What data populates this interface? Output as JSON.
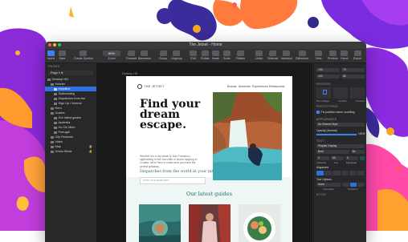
{
  "window": {
    "title": "The Jetset - Home"
  },
  "toolbar": {
    "left_items": [
      "Insert",
      "Data",
      "Create Symbol"
    ],
    "zoom_value": "80%",
    "zoom_label": "Zoom",
    "mid_items": [
      "Forward",
      "Backward",
      "Group",
      "Ungroup",
      "Edit",
      "Rotate",
      "Mask",
      "Scale",
      "Flatten",
      "Union",
      "Subtract",
      "Intersect",
      "Difference"
    ],
    "right_items": [
      "View",
      "Preview",
      "Cloud",
      "Export"
    ]
  },
  "layers_panel": {
    "header": "PAGES",
    "page_selector": "Page 1 ▾",
    "items": [
      {
        "label": "Desktop HD",
        "selected": false
      },
      {
        "label": "Header",
        "selected": false
      },
      {
        "label": "Headline",
        "selected": true
      },
      {
        "label": "Subheading",
        "selected": false
      },
      {
        "label": "Dispatches from the",
        "selected": false
      },
      {
        "label": "Sign Up / Normal",
        "selected": false
      },
      {
        "label": "Hero",
        "selected": false
      },
      {
        "label": "Guides",
        "selected": false
      },
      {
        "label": "Our latest guides",
        "selected": false
      },
      {
        "label": "Australia",
        "selected": false
      },
      {
        "label": "Ho Chi Minh",
        "selected": false
      },
      {
        "label": "Portugal",
        "selected": false
      },
      {
        "label": "City Features",
        "selected": false
      },
      {
        "label": "Video",
        "selected": false
      },
      {
        "label": "Map",
        "selected": false
      },
      {
        "label": "Green Block",
        "selected": false
      }
    ]
  },
  "canvas": {
    "artboard_label": "Desktop HD",
    "brand": "THE JETSET",
    "nav": [
      "Brands",
      "Moments",
      "Experiences",
      "Restaurants"
    ],
    "headline": "Find your dream escape.",
    "paragraph": "Whether it's a city break to San Francisco, sightseeing in the Sea cliffs or island hopping in Croatia, we're here to make sure you have the perfect getaway.",
    "subheading": "Dispatches from the world in your inbox",
    "email_placeholder": "Enter your email here",
    "guides_title": "Our latest guides"
  },
  "inspector": {
    "coords": [
      {
        "label": "X",
        "value": "100"
      },
      {
        "label": "Y",
        "value": "70"
      },
      {
        "label": "W",
        "value": "100"
      },
      {
        "label": "H",
        "value": "80"
      }
    ],
    "resizing_label": "RESIZING",
    "pin_labels": [
      "Pin to Edge",
      "Fix Size",
      "Preview"
    ],
    "prototyping_label": "PROTOTYPING",
    "fix_scroll_label": "Fix position when scrolling",
    "appearance_label": "APPEARANCE",
    "style_value": "No Shared Style",
    "opacity_label": "Opacity (Normal)",
    "opacity_value": "100%",
    "text_label": "TEXT",
    "font_family": "Playfair Display",
    "font_weight": "Bold",
    "font_size": "56",
    "font_metrics": [
      "0",
      "60",
      "0"
    ],
    "font_metric_labels": [
      "Character",
      "Line",
      "Paragraph"
    ],
    "weight_swatch": "#1f4b5a",
    "alignment_label": "Alignment",
    "options_label": "Text Options",
    "options_value": "None",
    "transform_labels": [
      "Decoration",
      "Transform"
    ],
    "style_section": "STYLE"
  }
}
